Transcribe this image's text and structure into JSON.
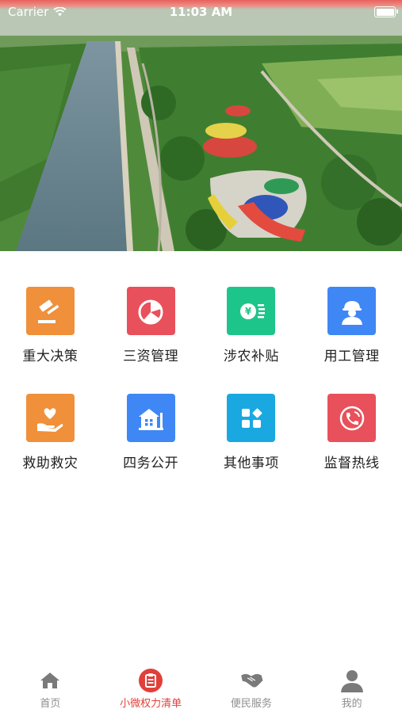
{
  "status_bar": {
    "carrier": "Carrier",
    "time": "11:03 AM"
  },
  "grid": [
    {
      "label": "重大决策",
      "icon": "gavel-icon",
      "color": "#f0903a"
    },
    {
      "label": "三资管理",
      "icon": "pie-chart-icon",
      "color": "#e8505b"
    },
    {
      "label": "涉农补贴",
      "icon": "yen-coin-icon",
      "color": "#1ec58a"
    },
    {
      "label": "用工管理",
      "icon": "worker-icon",
      "color": "#3f87f5"
    },
    {
      "label": "救助救灾",
      "icon": "hand-heart-icon",
      "color": "#f0903a"
    },
    {
      "label": "四务公开",
      "icon": "house-icon",
      "color": "#3f87f5"
    },
    {
      "label": "其他事项",
      "icon": "apps-icon",
      "color": "#1aa8e0"
    },
    {
      "label": "监督热线",
      "icon": "phone-icon",
      "color": "#e8505b"
    }
  ],
  "tabbar": {
    "items": [
      {
        "label": "首页",
        "icon": "home-icon",
        "active": false
      },
      {
        "label": "小微权力清单",
        "icon": "clipboard-icon",
        "active": true
      },
      {
        "label": "便民服务",
        "icon": "handshake-icon",
        "active": false
      },
      {
        "label": "我的",
        "icon": "user-icon",
        "active": false
      }
    ]
  },
  "colors": {
    "accent": "#e0403a",
    "inactive": "#8e8e8e"
  }
}
